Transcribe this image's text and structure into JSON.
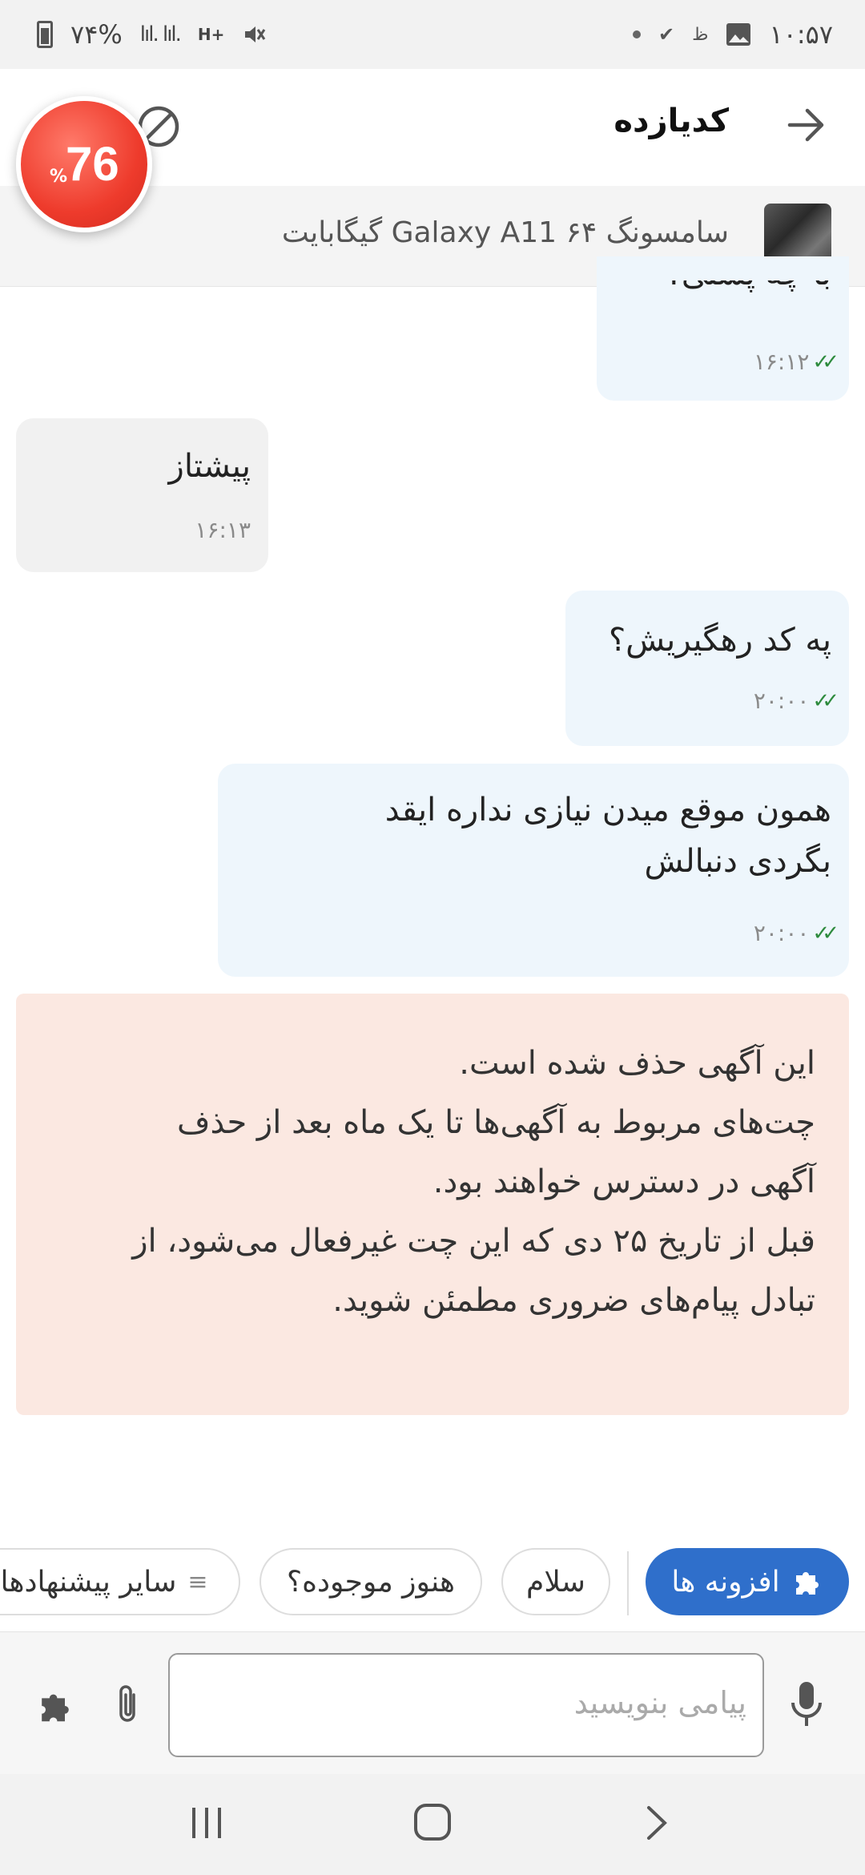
{
  "status_bar": {
    "time": "۱۰:۵۷",
    "battery": "۷۴%",
    "signal": "lıl. lıl.",
    "network": "H+"
  },
  "header": {
    "title": "کدیازده",
    "back_icon": "arrow-right-icon",
    "block_icon": "block-icon"
  },
  "badge": {
    "value": "76",
    "unit": "%"
  },
  "product": {
    "name": "سامسونگ Galaxy A11 ۶۴ گیگابایت"
  },
  "messages": [
    {
      "direction": "out",
      "text": "با چه پستی؟",
      "time": "۱۶:۱۲",
      "status": "read"
    },
    {
      "direction": "in",
      "text": "پیشتاز",
      "time": "۱۶:۱۳"
    },
    {
      "direction": "out",
      "text": "په کد رهگیریش؟",
      "time": "۲۰:۰۰",
      "status": "read"
    },
    {
      "direction": "out",
      "lines": [
        "همون موقع میدن نیازی نداره ایقد",
        "بگردی دنبالش"
      ],
      "time": "۲۰:۰۰",
      "status": "read"
    }
  ],
  "notice": {
    "lines": [
      "این آگهی حذف شده است.",
      "چت‌های مربوط به آگهی‌ها تا یک ماه بعد از حذف",
      "آگهی در دسترس خواهند بود.",
      "قبل از تاریخ ۲۵ دی که این چت غیرفعال می‌شود، از",
      "تبادل پیام‌های ضروری مطمئن شوید."
    ]
  },
  "chips": {
    "addons": "افزونه ها",
    "hello": "سلام",
    "still_available": "هنوز موجوده؟",
    "other_suggestions": "سایر پیشنهادها"
  },
  "input": {
    "placeholder": "پیامی بنویسید"
  },
  "colors": {
    "primary": "#2f6fcb",
    "outgoing_bubble": "#eef6fc",
    "incoming_bubble": "#f1f1f1",
    "notice_bg": "#fbe8e1",
    "badge": "#ee3b2c",
    "read_check": "#2e8b3e"
  }
}
